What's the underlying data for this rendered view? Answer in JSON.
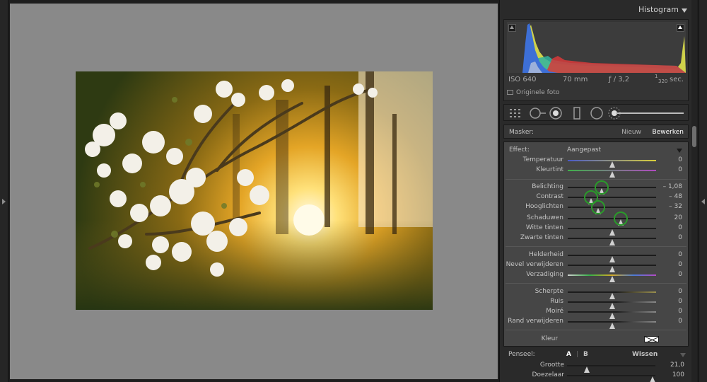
{
  "histogram": {
    "title": "Histogram",
    "exif": {
      "iso": "ISO 640",
      "focal": "70 mm",
      "aperture": "ƒ / 3,2",
      "shutter_num": "1",
      "shutter_den": "320",
      "shutter_unit": "sec."
    },
    "original_photo": "Originele foto"
  },
  "mask": {
    "label": "Masker:",
    "new": "Nieuw",
    "edit": "Bewerken"
  },
  "effect": {
    "label": "Effect:",
    "value": "Aangepast"
  },
  "sliders": [
    {
      "label": "Temperatuur",
      "value": "0",
      "position": 0.5
    },
    {
      "label": "Kleurtint",
      "value": "0",
      "position": 0.5
    },
    {
      "label": "Belichting",
      "value": "– 1,08",
      "position": 0.384
    },
    {
      "label": "Contrast",
      "value": "– 48",
      "position": 0.26
    },
    {
      "label": "Hooglichten",
      "value": "– 32",
      "position": 0.34
    },
    {
      "label": "Schaduwen",
      "value": "20",
      "position": 0.6
    },
    {
      "label": "Witte tinten",
      "value": "0",
      "position": 0.5
    },
    {
      "label": "Zwarte tinten",
      "value": "0",
      "position": 0.5
    },
    {
      "label": "Helderheid",
      "value": "0",
      "position": 0.5
    },
    {
      "label": "Nevel verwijderen",
      "value": "0",
      "position": 0.5
    },
    {
      "label": "Verzadiging",
      "value": "0",
      "position": 0.5
    },
    {
      "label": "Scherpte",
      "value": "0",
      "position": 0.5
    },
    {
      "label": "Ruis",
      "value": "0",
      "position": 0.5
    },
    {
      "label": "Moiré",
      "value": "0",
      "position": 0.5
    },
    {
      "label": "Rand verwijderen",
      "value": "0",
      "position": 0.5
    }
  ],
  "color": {
    "label": "Kleur"
  },
  "brush": {
    "label": "Penseel:",
    "a": "A",
    "separator": "|",
    "b": "B",
    "clear": "Wissen",
    "size": {
      "label": "Grootte",
      "value": "21,0",
      "position": 0.22
    },
    "feather": {
      "label": "Doezelaar",
      "value": "100",
      "position": 0.97
    }
  },
  "colors": {
    "panel_bg": "#2a2a2a",
    "adjust_bg": "#464646",
    "canvas_bg": "#898989",
    "highlight_ring": "#2a9a2a"
  }
}
